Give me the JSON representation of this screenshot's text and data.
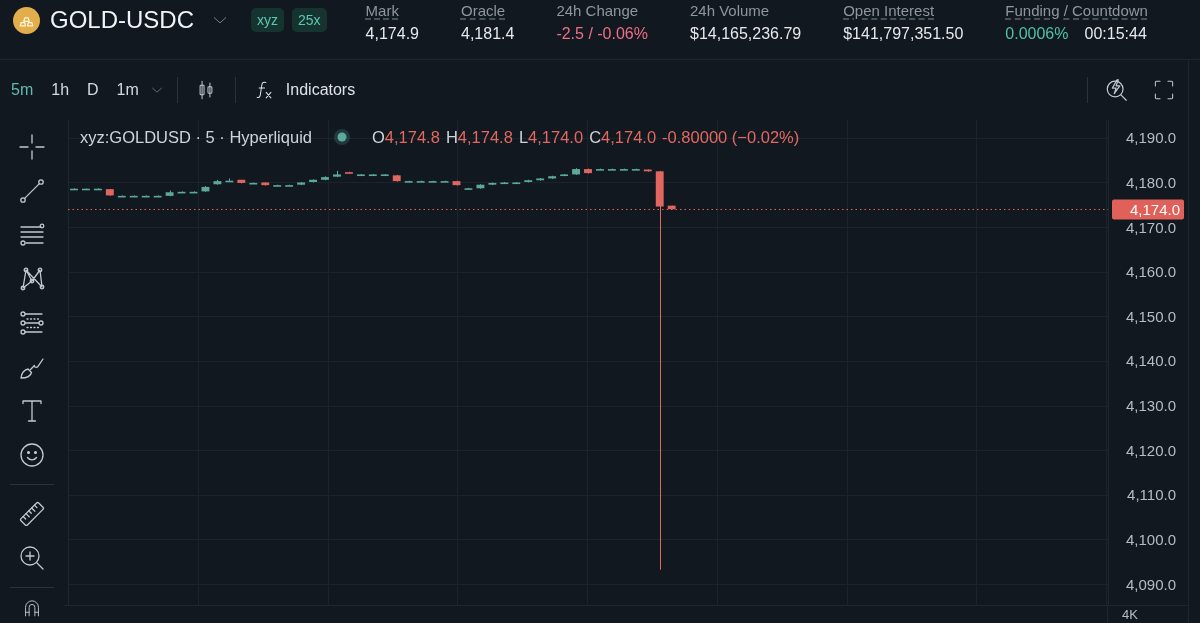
{
  "header": {
    "market": "GOLD-USDC",
    "badges": [
      "xyz",
      "25x"
    ],
    "stats": [
      {
        "label": "Mark",
        "tooltip": true,
        "values": [
          {
            "text": "4,174.9",
            "color": "#e6e8eb"
          }
        ]
      },
      {
        "label": "Oracle",
        "tooltip": true,
        "values": [
          {
            "text": "4,181.4",
            "color": "#e6e8eb"
          }
        ]
      },
      {
        "label": "24h Change",
        "tooltip": false,
        "values": [
          {
            "text": "-2.5 / -0.06%",
            "color": "#ec7084"
          }
        ]
      },
      {
        "label": "24h Volume",
        "tooltip": false,
        "values": [
          {
            "text": "$14,165,236.79",
            "color": "#e6e8eb"
          }
        ]
      },
      {
        "label": "Open Interest",
        "tooltip": true,
        "values": [
          {
            "text": "$141,797,351.50",
            "color": "#e6e8eb"
          }
        ]
      },
      {
        "label": "Funding / Countdown",
        "tooltip": true,
        "values": [
          {
            "text": "0.0006%",
            "color": "#4fc0a8"
          },
          {
            "text": "00:15:44",
            "color": "#e6e8eb"
          }
        ]
      }
    ]
  },
  "toolbar": {
    "timeframes": [
      {
        "label": "5m",
        "selected": true
      },
      {
        "label": "1h",
        "selected": false
      },
      {
        "label": "D",
        "selected": false
      },
      {
        "label": "1m",
        "selected": false
      }
    ],
    "indicators": "Indicators"
  },
  "chart": {
    "legend": {
      "title": "xyz:GOLDUSD · 5 · Hyperliquid",
      "ohlc": [
        {
          "key": "O",
          "value": "4,174.8"
        },
        {
          "key": "H",
          "value": "4,174.8"
        },
        {
          "key": "L",
          "value": "4,174.0"
        },
        {
          "key": "C",
          "value": "4,174.0"
        }
      ],
      "change": "-0.80000 (−0.02%)",
      "color": "#e3685f"
    },
    "chart_data": [
      {
        "type": "candlestick",
        "ylim": [
          4085.3,
          4194.0
        ],
        "grid": true,
        "categories": [
          null,
          null,
          null,
          null,
          null,
          null,
          null,
          null,
          null,
          null,
          null,
          null,
          null,
          null,
          null,
          null,
          null,
          null,
          null,
          null,
          null,
          null,
          null,
          null,
          null,
          null,
          null,
          null,
          null,
          null,
          null,
          null,
          null,
          null,
          null,
          null,
          null,
          null,
          null,
          null,
          null,
          null,
          null,
          null,
          null,
          null,
          null,
          null,
          null,
          null,
          null,
          null,
          null,
          null,
          null,
          null,
          null,
          null,
          null,
          null,
          null,
          null,
          null,
          null,
          null,
          null,
          null,
          null,
          null,
          null,
          null,
          null,
          null,
          null,
          null,
          null,
          null,
          null,
          null,
          null,
          null,
          null,
          null,
          null,
          null,
          null,
          null
        ],
        "yticks": [
          {
            "value": 4090,
            "label": "4,090.0"
          },
          {
            "value": 4100,
            "label": "4,100.0"
          },
          {
            "value": 4110,
            "label": "4,110.0"
          },
          {
            "value": 4120,
            "label": "4,120.0"
          },
          {
            "value": 4130,
            "label": "4,130.0"
          },
          {
            "value": 4140,
            "label": "4,140.0"
          },
          {
            "value": 4150,
            "label": "4,150.0"
          },
          {
            "value": 4160,
            "label": "4,160.0"
          },
          {
            "value": 4170,
            "label": "4,170.0"
          },
          {
            "value": 4180,
            "label": "4,180.0"
          },
          {
            "value": 4190,
            "label": "4,190.0"
          }
        ],
        "ref_lines": [
          {
            "axis": "y",
            "value": 4174.0,
            "label": "4,174.0",
            "color": "#e0605a",
            "line_style": "dotted"
          }
        ],
        "ohlc": [
          [
            4178.6,
            4178.7,
            4178.5,
            4178.6
          ],
          [
            4178.6,
            4178.7,
            4178.6,
            4178.6
          ],
          [
            4178.6,
            4178.7,
            4178.5,
            4178.6
          ],
          [
            4178.5,
            4178.5,
            4177.0,
            4177.1
          ],
          [
            4177.0,
            4177.1,
            4176.9,
            4177.0
          ],
          [
            4177.0,
            4177.1,
            4176.9,
            4177.0
          ],
          [
            4177.0,
            4177.1,
            4176.9,
            4177.0
          ],
          [
            4177.0,
            4177.1,
            4176.9,
            4177.0
          ],
          [
            4177.0,
            4178.2,
            4176.9,
            4177.8
          ],
          [
            4177.9,
            4178.0,
            4177.8,
            4177.9
          ],
          [
            4177.9,
            4178.0,
            4177.8,
            4177.9
          ],
          [
            4178.0,
            4179.2,
            4177.9,
            4179.0
          ],
          [
            4179.6,
            4180.6,
            4179.5,
            4180.3
          ],
          [
            4180.4,
            4180.9,
            4180.3,
            4180.4
          ],
          [
            4180.6,
            4180.6,
            4179.8,
            4179.9
          ],
          [
            4179.9,
            4180.0,
            4179.8,
            4179.9
          ],
          [
            4180.0,
            4180.0,
            4179.3,
            4179.4
          ],
          [
            4179.4,
            4179.5,
            4179.3,
            4179.4
          ],
          [
            4179.4,
            4179.5,
            4179.3,
            4179.4
          ],
          [
            4179.5,
            4180.1,
            4179.4,
            4180.0
          ],
          [
            4180.1,
            4180.7,
            4180.0,
            4180.6
          ],
          [
            4180.6,
            4181.4,
            4180.5,
            4181.2
          ],
          [
            4181.3,
            4182.6,
            4181.2,
            4181.8
          ],
          [
            4182.3,
            4182.4,
            4182.1,
            4182.2
          ],
          [
            4181.8,
            4181.9,
            4181.7,
            4181.8
          ],
          [
            4181.8,
            4181.9,
            4181.7,
            4181.8
          ],
          [
            4181.8,
            4181.9,
            4181.7,
            4181.8
          ],
          [
            4181.6,
            4181.7,
            4180.2,
            4180.3
          ],
          [
            4180.3,
            4180.4,
            4180.2,
            4180.3
          ],
          [
            4180.3,
            4180.4,
            4180.2,
            4180.3
          ],
          [
            4180.3,
            4180.4,
            4180.2,
            4180.3
          ],
          [
            4180.3,
            4180.4,
            4180.2,
            4180.3
          ],
          [
            4180.3,
            4180.4,
            4179.3,
            4179.4
          ],
          [
            4178.6,
            4178.8,
            4178.5,
            4178.7
          ],
          [
            4178.7,
            4179.6,
            4178.6,
            4179.5
          ],
          [
            4179.5,
            4180.0,
            4179.4,
            4179.9
          ],
          [
            4179.9,
            4180.1,
            4179.8,
            4180.0
          ],
          [
            4180.0,
            4180.1,
            4179.9,
            4180.0
          ],
          [
            4180.1,
            4180.6,
            4180.0,
            4180.5
          ],
          [
            4180.5,
            4181.0,
            4180.4,
            4180.9
          ],
          [
            4180.9,
            4181.5,
            4180.8,
            4181.4
          ],
          [
            4181.5,
            4181.9,
            4181.4,
            4181.8
          ],
          [
            4181.8,
            4183.2,
            4181.7,
            4183.0
          ],
          [
            4183.0,
            4183.1,
            4182.0,
            4182.1
          ],
          [
            4183.0,
            4183.1,
            4182.9,
            4183.0
          ],
          [
            4183.0,
            4183.1,
            4182.9,
            4183.0
          ],
          [
            4183.0,
            4183.1,
            4182.9,
            4183.0
          ],
          [
            4183.0,
            4183.1,
            4182.9,
            4183.0
          ],
          [
            4182.9,
            4182.9,
            4182.4,
            4182.5
          ],
          [
            4182.5,
            4182.6,
            4093.2,
            4174.6
          ],
          [
            4174.8,
            4174.8,
            4174.0,
            4174.0
          ],
          null,
          null,
          null,
          null,
          null,
          null,
          null,
          null,
          null,
          null,
          null,
          null,
          null,
          null,
          null,
          null,
          null,
          null,
          null,
          null,
          null,
          null,
          null,
          null,
          null,
          null,
          null,
          null,
          null,
          null,
          null,
          null,
          null,
          null,
          null,
          null
        ]
      }
    ],
    "volume_axis_label": "4K"
  }
}
